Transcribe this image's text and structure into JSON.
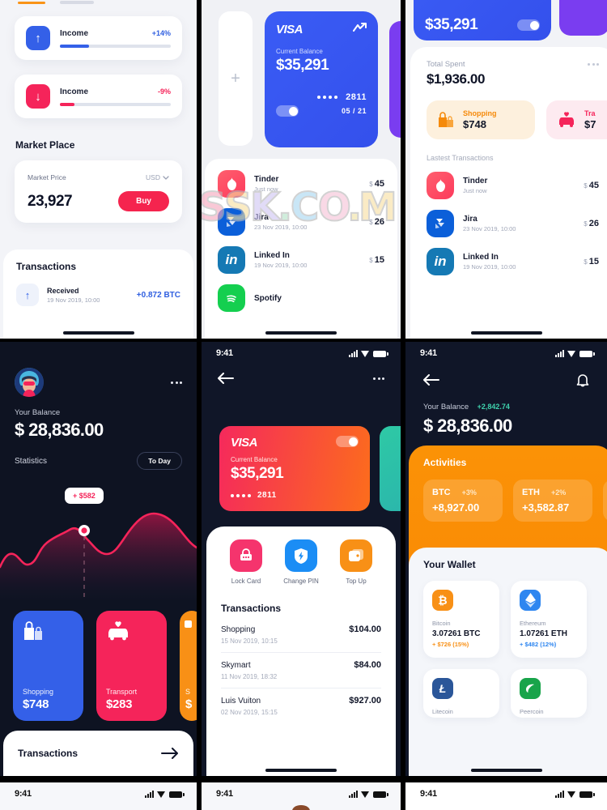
{
  "status_bar": {
    "time": "9:41"
  },
  "panel1": {
    "income_up": {
      "label": "Income",
      "pct": "+14%",
      "icon": "arrow-up-icon",
      "fill_pct": 26,
      "color": "#3460e8"
    },
    "income_down": {
      "label": "Income",
      "pct": "-9%",
      "icon": "arrow-down-icon",
      "fill_pct": 13,
      "color": "#f5245a"
    },
    "market_title": "Market Place",
    "market": {
      "label": "Market Price",
      "currency": "USD",
      "price": "23,927",
      "buy_label": "Buy"
    },
    "transactions_title": "Transactions",
    "transaction": {
      "name": "Received",
      "date": "19 Nov 2019, 10:00",
      "amount": "+0.872 BTC",
      "icon": "arrow-up-icon"
    }
  },
  "panel2": {
    "add_card": "+",
    "card": {
      "brand": "VISA",
      "balance_label": "Current Balance",
      "balance": "$35,291",
      "dots": "••••",
      "last4": "2811",
      "expiry": "05 / 21",
      "trend_icon": "trend-up-icon"
    },
    "list": [
      {
        "name": "Tinder",
        "date": "Just now",
        "amount": "45",
        "currency": "$",
        "icon": "tinder-icon",
        "color": "#fd4a6e"
      },
      {
        "name": "Jira",
        "date": "23 Nov 2019, 10:00",
        "amount": "26",
        "currency": "$",
        "icon": "jira-icon",
        "color": "#0b5fd9"
      },
      {
        "name": "Linked In",
        "date": "19 Nov 2019, 10:00",
        "amount": "15",
        "currency": "$",
        "icon": "linkedin-icon",
        "color": "#1579b4"
      },
      {
        "name": "Spotify",
        "date": "",
        "amount": "",
        "currency": "",
        "icon": "spotify-icon",
        "color": "#14cf4f"
      }
    ],
    "watermark": "SSK.CO.COM"
  },
  "panel3": {
    "card_balance": "$35,291",
    "total_spent_label": "Total Spent",
    "total_spent": "$1,936.00",
    "more_icon": "ellipsis-icon",
    "chips": [
      {
        "label": "Shopping",
        "value": "$748",
        "icon": "shopping-bag-icon",
        "bg": "#fdf0dd",
        "fg": "#f58a0b"
      },
      {
        "label": "Tra",
        "value": "$7",
        "icon": "car-heart-icon",
        "bg": "#fdeaf0",
        "fg": "#f5245a"
      }
    ],
    "latest_title": "Lastest Transactions",
    "list": [
      {
        "name": "Tinder",
        "date": "Just now",
        "amount": "45",
        "currency": "$",
        "icon": "tinder-icon",
        "color": "#fd4a6e"
      },
      {
        "name": "Jira",
        "date": "23 Nov 2019, 10:00",
        "amount": "26",
        "currency": "$",
        "icon": "jira-icon",
        "color": "#0b5fd9"
      },
      {
        "name": "Linked In",
        "date": "19 Nov 2019, 10:00",
        "amount": "15",
        "currency": "$",
        "icon": "linkedin-icon",
        "color": "#1579b4"
      }
    ]
  },
  "panel4": {
    "more_icon": "ellipsis-icon",
    "avatar": "user-avatar",
    "balance_label": "Your Balance",
    "balance": "$ 28,836.00",
    "statistics_label": "Statistics",
    "period": "To Day",
    "tooltip": "+ $582",
    "categories": [
      {
        "label": "Shopping",
        "value": "$748",
        "icon": "shopping-bag-icon",
        "color": "#3460e8"
      },
      {
        "label": "Transport",
        "value": "$283",
        "icon": "car-heart-icon",
        "color": "#f5245a"
      },
      {
        "label": "S",
        "value": "$",
        "icon": "card-icon",
        "color": "#f89016"
      }
    ],
    "transactions_label": "Transactions",
    "arrow_icon": "arrow-right-icon",
    "chart_data": {
      "type": "area",
      "title": "Statistics",
      "x": [
        0,
        1,
        2,
        3,
        4,
        5,
        6,
        7,
        8,
        9,
        10
      ],
      "values": [
        40,
        28,
        52,
        38,
        86,
        92,
        70,
        58,
        74,
        104,
        96
      ],
      "highlight_index": 5,
      "highlight_label": "+ $582",
      "line_color": "#f5245a",
      "fill_color": "#6b1234",
      "grid": false,
      "xlabel": "",
      "ylabel": ""
    }
  },
  "panel5": {
    "back_icon": "arrow-left-icon",
    "more_icon": "ellipsis-icon",
    "card": {
      "brand": "VISA",
      "balance_label": "Current Balance",
      "balance": "$35,291",
      "dots": "••••",
      "last4": "2811"
    },
    "actions": [
      {
        "label": "Lock Card",
        "icon": "lock-card-icon",
        "color": "#f5346d"
      },
      {
        "label": "Change PIN",
        "icon": "shield-bolt-icon",
        "color": "#1b8df5"
      },
      {
        "label": "Top Up",
        "icon": "wallet-icon",
        "color": "#f89016"
      }
    ],
    "transactions_title": "Transactions",
    "transactions": [
      {
        "name": "Shopping",
        "amount": "$104.00",
        "date": "15 Nov 2019, 10:15"
      },
      {
        "name": "Skymart",
        "amount": "$84.00",
        "date": "11 Nov 2019, 18:32"
      },
      {
        "name": "Luis Vuiton",
        "amount": "$927.00",
        "date": "02 Nov 2019, 15:15"
      }
    ]
  },
  "panel6": {
    "back_icon": "arrow-left-icon",
    "bell_icon": "bell-icon",
    "balance_label": "Your Balance",
    "balance_change": "+2,842.74",
    "balance": "$ 28,836.00",
    "activities_title": "Activities",
    "activities": [
      {
        "symbol": "BTC",
        "pct": "+3%",
        "value": "+8,927.00"
      },
      {
        "symbol": "ETH",
        "pct": "+2%",
        "value": "+3,582.87"
      }
    ],
    "wallet_title": "Your Wallet",
    "wallet": [
      {
        "name": "Bitcoin",
        "amount": "3.07261 BTC",
        "change": "+ $726 (15%)",
        "icon": "bitcoin-icon",
        "color": "#f89016",
        "chg_color": "#f89016"
      },
      {
        "name": "Ethereum",
        "amount": "1.07261 ETH",
        "change": "+ $482 (12%)",
        "icon": "ethereum-icon",
        "color": "#2e86f0",
        "chg_color": "#2e86f0"
      },
      {
        "name": "Litecoin",
        "amount": "",
        "change": "",
        "icon": "litecoin-icon",
        "color": "#2a5699",
        "chg_color": "#2a5699"
      },
      {
        "name": "Peercoin",
        "amount": "",
        "change": "",
        "icon": "peercoin-icon",
        "color": "#18a44a",
        "chg_color": "#18a44a"
      }
    ]
  }
}
